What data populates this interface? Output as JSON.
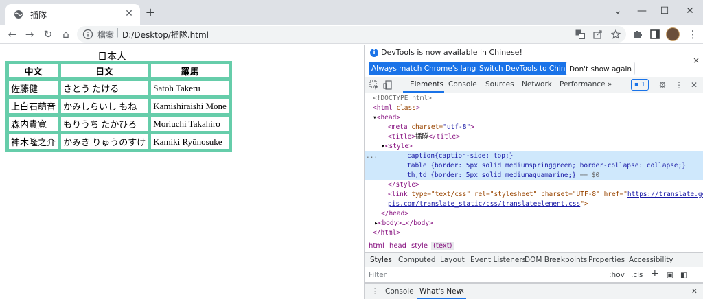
{
  "browser": {
    "tab_title": "插隊",
    "tab_close": "✕",
    "new_tab": "+",
    "controls": {
      "minimize": "—",
      "maximize": "☐",
      "close": "✕",
      "expand": "⌄"
    }
  },
  "toolbar": {
    "back": "←",
    "forward": "→",
    "reload": "↻",
    "home": "⌂",
    "scheme_label": "檔案",
    "separator": "|",
    "url": "D:/Desktop/插隊.html",
    "menu": "⋮"
  },
  "page": {
    "caption": "日本人",
    "headers": [
      "中文",
      "日文",
      "羅馬"
    ],
    "rows": [
      [
        "佐藤健",
        "さとう たける",
        "Satoh Takeru"
      ],
      [
        "上白石萌音",
        "かみしらいし もね",
        "Kamishiraishi Mone"
      ],
      [
        "森内貴寛",
        "もりうち たかひろ",
        "Moriuchi Takahiro"
      ],
      [
        "神木隆之介",
        "かみき りゅうのすけ",
        "Kamiki Ryūnosuke"
      ]
    ],
    "colors": {
      "table_border": "#00fa9a",
      "cell_border": "#66cdaa"
    }
  },
  "devtools": {
    "infobar": {
      "message": "DevTools is now available in Chinese!",
      "btn_match": "Always match Chrome's language",
      "btn_switch": "Switch DevTools to Chinese",
      "btn_dismiss": "Don't show again",
      "close": "×"
    },
    "tabs": [
      "Elements",
      "Console",
      "Sources",
      "Network",
      "Performance"
    ],
    "more_tabs": "»",
    "issues_count": "1",
    "dom": {
      "doctype": "<!DOCTYPE html>",
      "html_open_tag": "<html",
      "html_attr": " class",
      "html_close_bracket": ">",
      "head_open": "<head>",
      "meta_tag": "<meta",
      "meta_attr": " charset=",
      "meta_val": "\"utf-8\"",
      "meta_end": ">",
      "title_open": "<title>",
      "title_text": "插隊",
      "title_close": "</title>",
      "style_open": "<style>",
      "css1": "caption{caption-side: top;}",
      "css2": "table {border: 5px solid mediumspringgreen; border-collapse: collapse;}",
      "css3": "th,td {border: 5px solid mediumaquamarine;}",
      "css3_suffix": " == $0",
      "style_close": "</style>",
      "link_tag": "<link",
      "link_attrs": " type=\"text/css\" rel=\"stylesheet\" charset=\"UTF-8\" href=\"",
      "link_href_1": "https://translate.googlea",
      "link_href_2": "pis.com/translate_static/css/translateelement.css",
      "link_end": "\">",
      "head_close": "</head>",
      "body_collapsed": "<body>…</body>",
      "html_close": "</html>",
      "ellipsis": "..."
    },
    "breadcrumbs": [
      "html",
      "head",
      "style",
      "(text)"
    ],
    "styles_tabs": [
      "Styles",
      "Computed",
      "Layout",
      "Event Listeners",
      "DOM Breakpoints",
      "Properties",
      "Accessibility"
    ],
    "filter_placeholder": "Filter",
    "hov": ":hov",
    "cls": ".cls",
    "plus": "+",
    "drawer_tabs": [
      "Console",
      "What's New"
    ],
    "drawer_close": "✕"
  }
}
